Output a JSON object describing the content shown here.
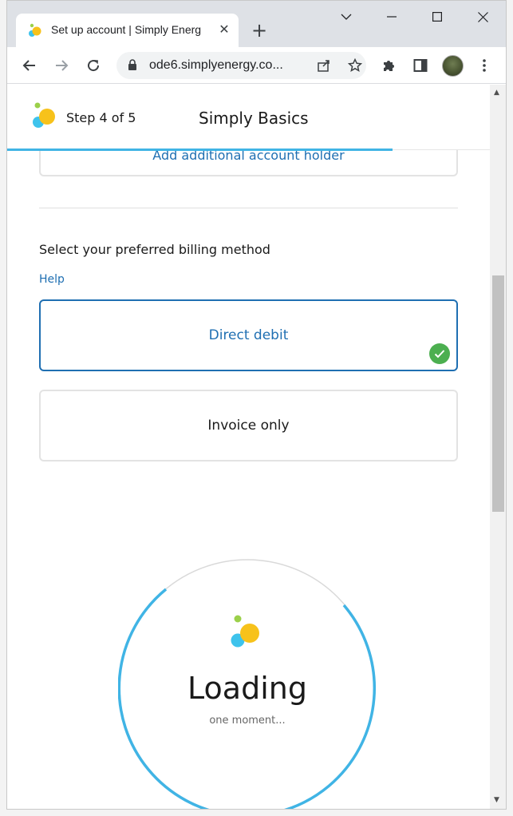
{
  "browser": {
    "tab_title": "Set up account | Simply Energ",
    "url": "ode6.simplyenergy.co...",
    "icons": {
      "tab_close": "close-icon",
      "new_tab": "plus-icon",
      "back": "arrow-left-icon",
      "forward": "arrow-right-icon",
      "reload": "reload-icon",
      "lock": "lock-icon",
      "share": "share-icon",
      "bookmark": "star-icon",
      "extensions": "puzzle-icon",
      "side_panel": "side-panel-icon",
      "menu": "kebab-menu-icon"
    }
  },
  "header": {
    "step": "Step 4 of 5",
    "title": "Simply Basics"
  },
  "form": {
    "add_holder_label": "Add additional account holder",
    "section_label": "Select your preferred billing method",
    "help_link": "Help",
    "options": [
      {
        "label": "Direct debit",
        "selected": true
      },
      {
        "label": "Invoice only",
        "selected": false
      }
    ]
  },
  "loader": {
    "title": "Loading",
    "subtitle": "one moment..."
  },
  "colors": {
    "accent": "#1f6fb2",
    "progress": "#40b4e5",
    "success": "#4caf50"
  }
}
